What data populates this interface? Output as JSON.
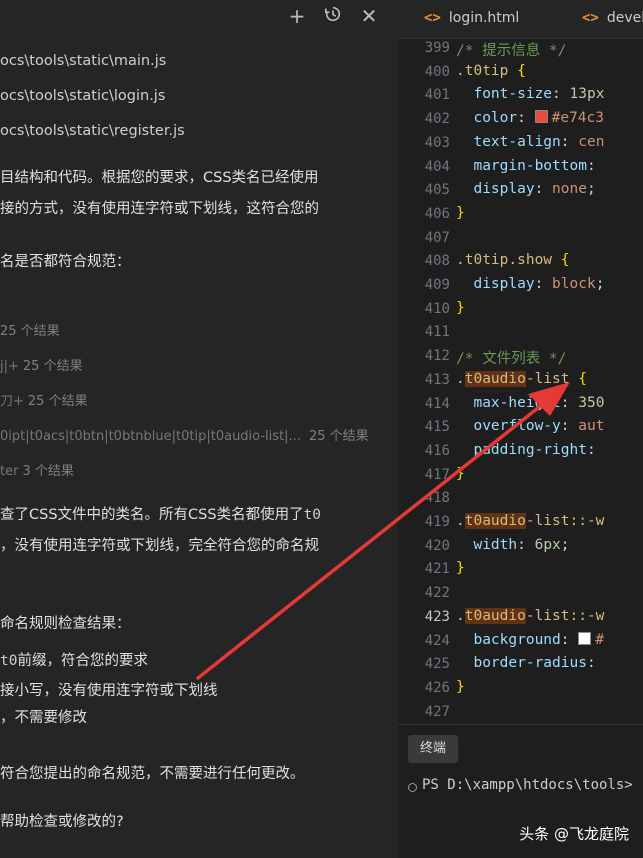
{
  "chat": {
    "icons": [
      "plus-icon",
      "history-icon",
      "close-icon"
    ],
    "files": [
      "ocs\\tools\\static\\main.js",
      "ocs\\tools\\static\\login.js",
      "ocs\\tools\\static\\register.js"
    ],
    "intro_1": "目结构和代码。根据您的要求，CSS类名已经使用",
    "intro_2": "接的方式，没有使用连字符或下划线，这符合您的",
    "check_line": "名是否都符合规范：",
    "searches": [
      {
        "text": "",
        "count": "25 个结果"
      },
      {
        "text": "j|+",
        "count": "25 个结果"
      },
      {
        "text": "刀+",
        "count": "25 个结果"
      },
      {
        "text": "0ipt|t0acs|t0btn|t0btnblue|t0tip|t0audio-list|...",
        "count": "25 个结果"
      },
      {
        "text": "ter",
        "count": "3 个结果"
      }
    ],
    "result_1_prefix": "查了CSS文件中的类名。所有CSS类名都使用了",
    "result_1_code": "t0",
    "result_2": "，没有使用连字符或下划线，完全符合您的命名规",
    "summary_title": "命名规则检查结果：",
    "bullet_1_code": "t0",
    "bullet_1_text": "前缀，符合您的要求",
    "bullet_2": "接小写，没有使用连字符或下划线",
    "bullet_3": "，不需要修改",
    "conclusion": "符合您提出的命名规范，不需要进行任何更改。",
    "question": "帮助检查或修改的?"
  },
  "editor": {
    "tabs": [
      {
        "icon": "<>",
        "label": "login.html"
      },
      {
        "icon": "<>",
        "label": "devel"
      }
    ],
    "active_line": "423",
    "lines": [
      {
        "n": "399",
        "t": [
          [
            "c-cmt",
            "/* 提示信息 */"
          ]
        ]
      },
      {
        "n": "400",
        "t": [
          [
            "c-sel",
            ".t0tip "
          ],
          [
            "c-br",
            "{"
          ]
        ]
      },
      {
        "n": "401",
        "t": [
          [
            "",
            "  "
          ],
          [
            "c-prop",
            "font-size"
          ],
          [
            "",
            ": "
          ],
          [
            "c-num",
            "13px"
          ]
        ]
      },
      {
        "n": "402",
        "t": [
          [
            "",
            "  "
          ],
          [
            "c-prop",
            "color"
          ],
          [
            "",
            ": "
          ],
          [
            "swatch",
            "#e74c3c"
          ],
          [
            "c-val",
            "#e74c3"
          ]
        ]
      },
      {
        "n": "403",
        "t": [
          [
            "",
            "  "
          ],
          [
            "c-prop",
            "text-align"
          ],
          [
            "",
            ": "
          ],
          [
            "c-val",
            "cen"
          ]
        ]
      },
      {
        "n": "404",
        "t": [
          [
            "",
            "  "
          ],
          [
            "c-prop",
            "margin-bottom"
          ],
          [
            "",
            ":"
          ]
        ]
      },
      {
        "n": "405",
        "t": [
          [
            "",
            "  "
          ],
          [
            "c-prop",
            "display"
          ],
          [
            "",
            ": "
          ],
          [
            "c-val",
            "none"
          ],
          [
            "",
            ";"
          ]
        ]
      },
      {
        "n": "406",
        "t": [
          [
            "c-br",
            "}"
          ]
        ]
      },
      {
        "n": "407",
        "t": []
      },
      {
        "n": "408",
        "t": [
          [
            "c-sel",
            ".t0tip.show "
          ],
          [
            "c-br",
            "{"
          ]
        ]
      },
      {
        "n": "409",
        "t": [
          [
            "",
            "  "
          ],
          [
            "c-prop",
            "display"
          ],
          [
            "",
            ": "
          ],
          [
            "c-val",
            "block"
          ],
          [
            "",
            ";"
          ]
        ]
      },
      {
        "n": "410",
        "t": [
          [
            "c-br",
            "}"
          ]
        ]
      },
      {
        "n": "411",
        "t": []
      },
      {
        "n": "412",
        "t": [
          [
            "c-cmt",
            "/* 文件列表 */"
          ]
        ]
      },
      {
        "n": "413",
        "t": [
          [
            "c-sel",
            "."
          ],
          [
            "hl",
            "t0audio"
          ],
          [
            "c-sel",
            "-list "
          ],
          [
            "c-br",
            "{"
          ]
        ]
      },
      {
        "n": "414",
        "t": [
          [
            "",
            "  "
          ],
          [
            "c-prop",
            "max-height"
          ],
          [
            "",
            ": "
          ],
          [
            "c-num",
            "350"
          ]
        ]
      },
      {
        "n": "415",
        "t": [
          [
            "",
            "  "
          ],
          [
            "c-prop",
            "overflow-y"
          ],
          [
            "",
            ": "
          ],
          [
            "c-val",
            "aut"
          ]
        ]
      },
      {
        "n": "416",
        "t": [
          [
            "",
            "  "
          ],
          [
            "c-prop",
            "padding-right"
          ],
          [
            "",
            ":"
          ]
        ]
      },
      {
        "n": "417",
        "t": [
          [
            "c-br",
            "}"
          ]
        ]
      },
      {
        "n": "418",
        "t": []
      },
      {
        "n": "419",
        "t": [
          [
            "c-sel",
            "."
          ],
          [
            "hl",
            "t0audio"
          ],
          [
            "c-sel",
            "-list::-w"
          ]
        ]
      },
      {
        "n": "420",
        "t": [
          [
            "",
            "  "
          ],
          [
            "c-prop",
            "width"
          ],
          [
            "",
            ": "
          ],
          [
            "c-num",
            "6px"
          ],
          [
            "",
            ";"
          ]
        ]
      },
      {
        "n": "421",
        "t": [
          [
            "c-br",
            "}"
          ]
        ]
      },
      {
        "n": "422",
        "t": []
      },
      {
        "n": "423",
        "t": [
          [
            "c-sel",
            "."
          ],
          [
            "hl",
            "t0audio"
          ],
          [
            "c-sel",
            "-list::-w"
          ]
        ]
      },
      {
        "n": "424",
        "t": [
          [
            "",
            "  "
          ],
          [
            "c-prop",
            "background"
          ],
          [
            "",
            ": "
          ],
          [
            "swatch",
            "#ffffff"
          ],
          [
            "c-val",
            "#"
          ]
        ]
      },
      {
        "n": "425",
        "t": [
          [
            "",
            "  "
          ],
          [
            "c-prop",
            "border-radius"
          ],
          [
            "",
            ":"
          ]
        ]
      },
      {
        "n": "426",
        "t": [
          [
            "c-br",
            "}"
          ]
        ]
      },
      {
        "n": "427",
        "t": []
      }
    ]
  },
  "terminal": {
    "tab_label": "终端",
    "prompt": "PS D:\\xampp\\htdocs\\tools>"
  },
  "watermark": "头条 @飞龙庭院",
  "colors": {
    "arrow": "#e53935",
    "highlight": "#613214",
    "swatch_red": "#e74c3c"
  }
}
